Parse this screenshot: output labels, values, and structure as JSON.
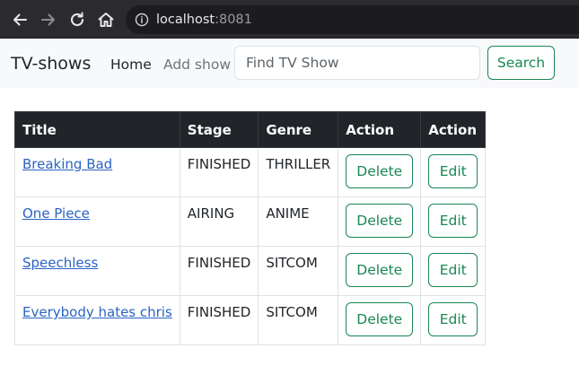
{
  "browser": {
    "url_host": "localhost",
    "url_port": ":8081",
    "icons": [
      "back-arrow-icon",
      "forward-arrow-icon",
      "reload-icon",
      "home-icon",
      "info-icon"
    ]
  },
  "navbar": {
    "brand": "TV-shows",
    "links": [
      {
        "label": "Home"
      },
      {
        "label": "Add show"
      }
    ],
    "search": {
      "placeholder": "Find TV Show",
      "value": "",
      "button_label": "Search"
    }
  },
  "table": {
    "headers": [
      "Title",
      "Stage",
      "Genre",
      "Action",
      "Action"
    ],
    "rows": [
      {
        "title": "Breaking Bad",
        "stage": "FINISHED",
        "genre": "THRILLER",
        "delete_label": "Delete",
        "edit_label": "Edit"
      },
      {
        "title": "One Piece",
        "stage": "AIRING",
        "genre": "ANIME",
        "delete_label": "Delete",
        "edit_label": "Edit"
      },
      {
        "title": "Speechless",
        "stage": "FINISHED",
        "genre": "SITCOM",
        "delete_label": "Delete",
        "edit_label": "Edit"
      },
      {
        "title": "Everybody hates chris",
        "stage": "FINISHED",
        "genre": "SITCOM",
        "delete_label": "Delete",
        "edit_label": "Edit"
      }
    ]
  },
  "colors": {
    "chrome_bg": "#2b2b2f",
    "navbar_bg": "#f8f9fa",
    "table_header_bg": "#212529",
    "accent_green": "#198754",
    "link_blue": "#2a63c4"
  }
}
